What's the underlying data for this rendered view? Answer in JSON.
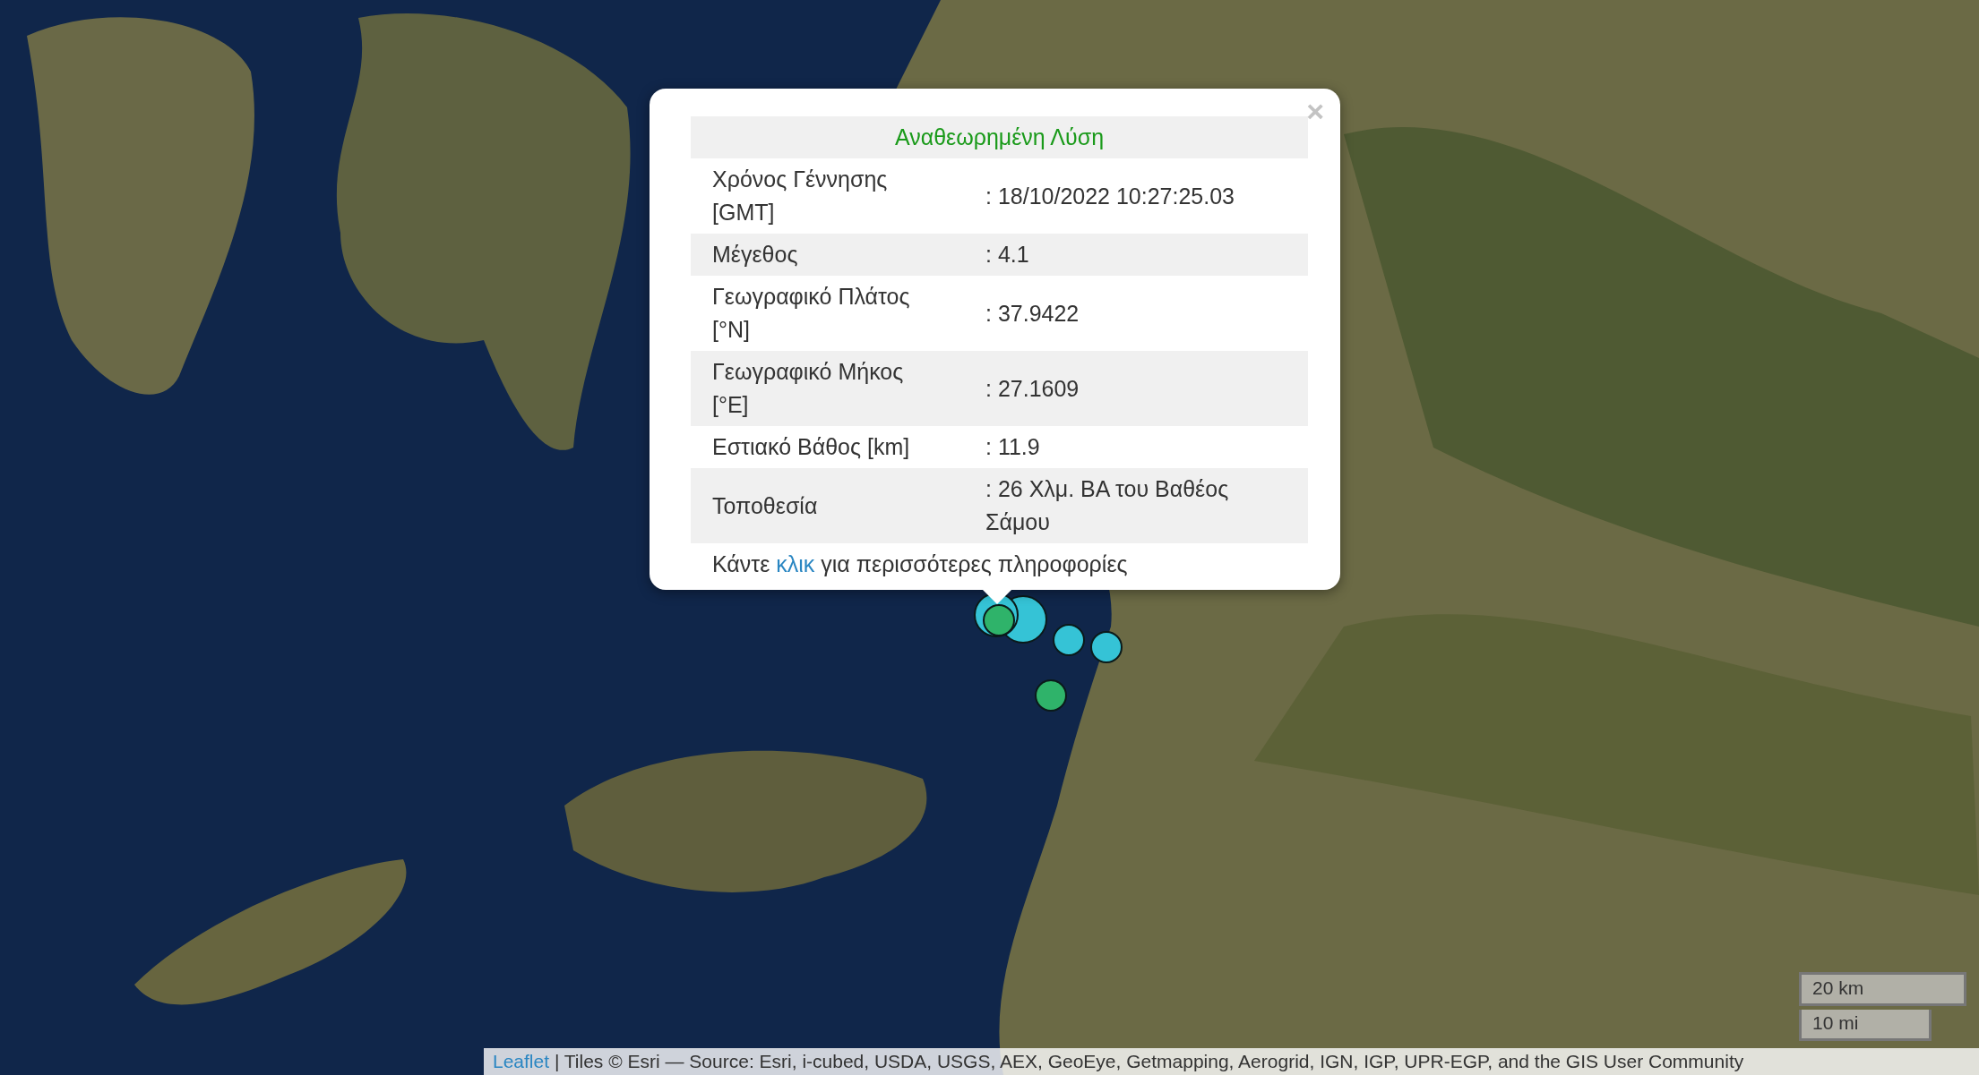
{
  "map": {
    "markers": [
      {
        "color": "#35c3d6"
      },
      {
        "color": "#35c3d6"
      },
      {
        "color": "#2fb36a"
      },
      {
        "color": "#35c3d6"
      },
      {
        "color": "#35c3d6"
      },
      {
        "color": "#2fb36a"
      }
    ]
  },
  "popup": {
    "close": "×",
    "title": "Αναθεωρημένη Λύση",
    "rows": [
      {
        "label": "Χρόνος Γέννησης [GMT]",
        "value": ": 18/10/2022 10:27:25.03"
      },
      {
        "label": "Μέγεθος",
        "value": ": 4.1"
      },
      {
        "label": "Γεωγραφικό Πλάτος [°N]",
        "value": ": 37.9422"
      },
      {
        "label": "Γεωγραφικό Μήκος [°E]",
        "value": ": 27.1609"
      },
      {
        "label": "Εστιακό Βάθος [km]",
        "value": ": 11.9"
      },
      {
        "label": "Τοποθεσία",
        "value": ": 26 Χλμ. ΒΑ του Βαθέος Σάμου"
      }
    ],
    "footer": {
      "before": "Κάντε",
      "link": "κλικ",
      "after": "για περισσότερες πληροφορίες"
    }
  },
  "scale": {
    "metric": "20 km",
    "imperial": "10 mi"
  },
  "attribution": {
    "link": "Leaflet",
    "text": "| Tiles © Esri — Source: Esri, i-cubed, USDA, USGS, AEX, GeoEye, Getmapping, Aerogrid, IGN, IGP, UPR-EGP, and the GIS User Community"
  }
}
